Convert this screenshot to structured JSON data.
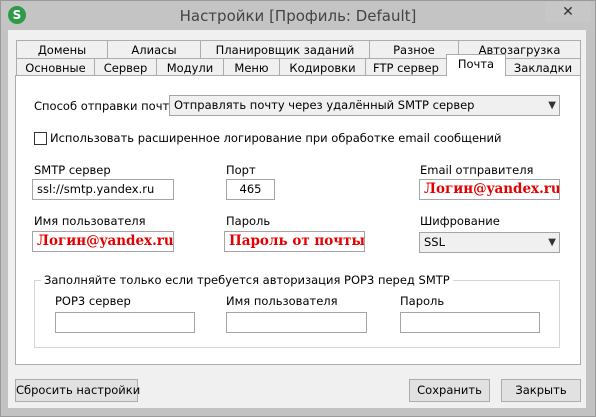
{
  "window": {
    "title": "Настройки [Профиль: Default]",
    "app_icon_letter": "S",
    "close_glyph": "✕"
  },
  "tabs": {
    "row1": [
      "Домены",
      "Алиасы",
      "Планировщик заданий",
      "Разное",
      "Автозагрузка"
    ],
    "row2": [
      "Основные",
      "Сервер",
      "Модули",
      "Меню",
      "Кодировки",
      "FTP сервер",
      "Почта",
      "Закладки"
    ],
    "active": "Почта"
  },
  "mail": {
    "send_method_label": "Способ отправки почты:",
    "send_method_value": "Отправлять почту через удалённый SMTP сервер",
    "extended_logging_label": "Использовать расширенное логирование при обработке email сообщений",
    "extended_logging_checked": false,
    "smtp_server_label": "SMTP сервер",
    "smtp_server_value": "ssl://smtp.yandex.ru",
    "port_label": "Порт",
    "port_value": "465",
    "sender_email_label": "Email отправителя",
    "sender_email_value": "Логин@yandex.ru",
    "username_label": "Имя пользователя",
    "username_value": "Логин@yandex.ru",
    "password_label": "Пароль",
    "password_value": "Пароль от почты",
    "encryption_label": "Шифрование",
    "encryption_value": "SSL"
  },
  "pop3": {
    "legend": "Заполняйте только если требуется авторизация POP3 перед SMTP",
    "server_label": "POP3 сервер",
    "server_value": "",
    "username_label": "Имя пользователя",
    "username_value": "",
    "password_label": "Пароль",
    "password_value": ""
  },
  "buttons": {
    "reset": "Сбросить настройки",
    "save": "Сохранить",
    "close": "Закрыть"
  },
  "colors": {
    "highlight_red": "#e30000",
    "app_icon_green": "#2e9b4a"
  }
}
